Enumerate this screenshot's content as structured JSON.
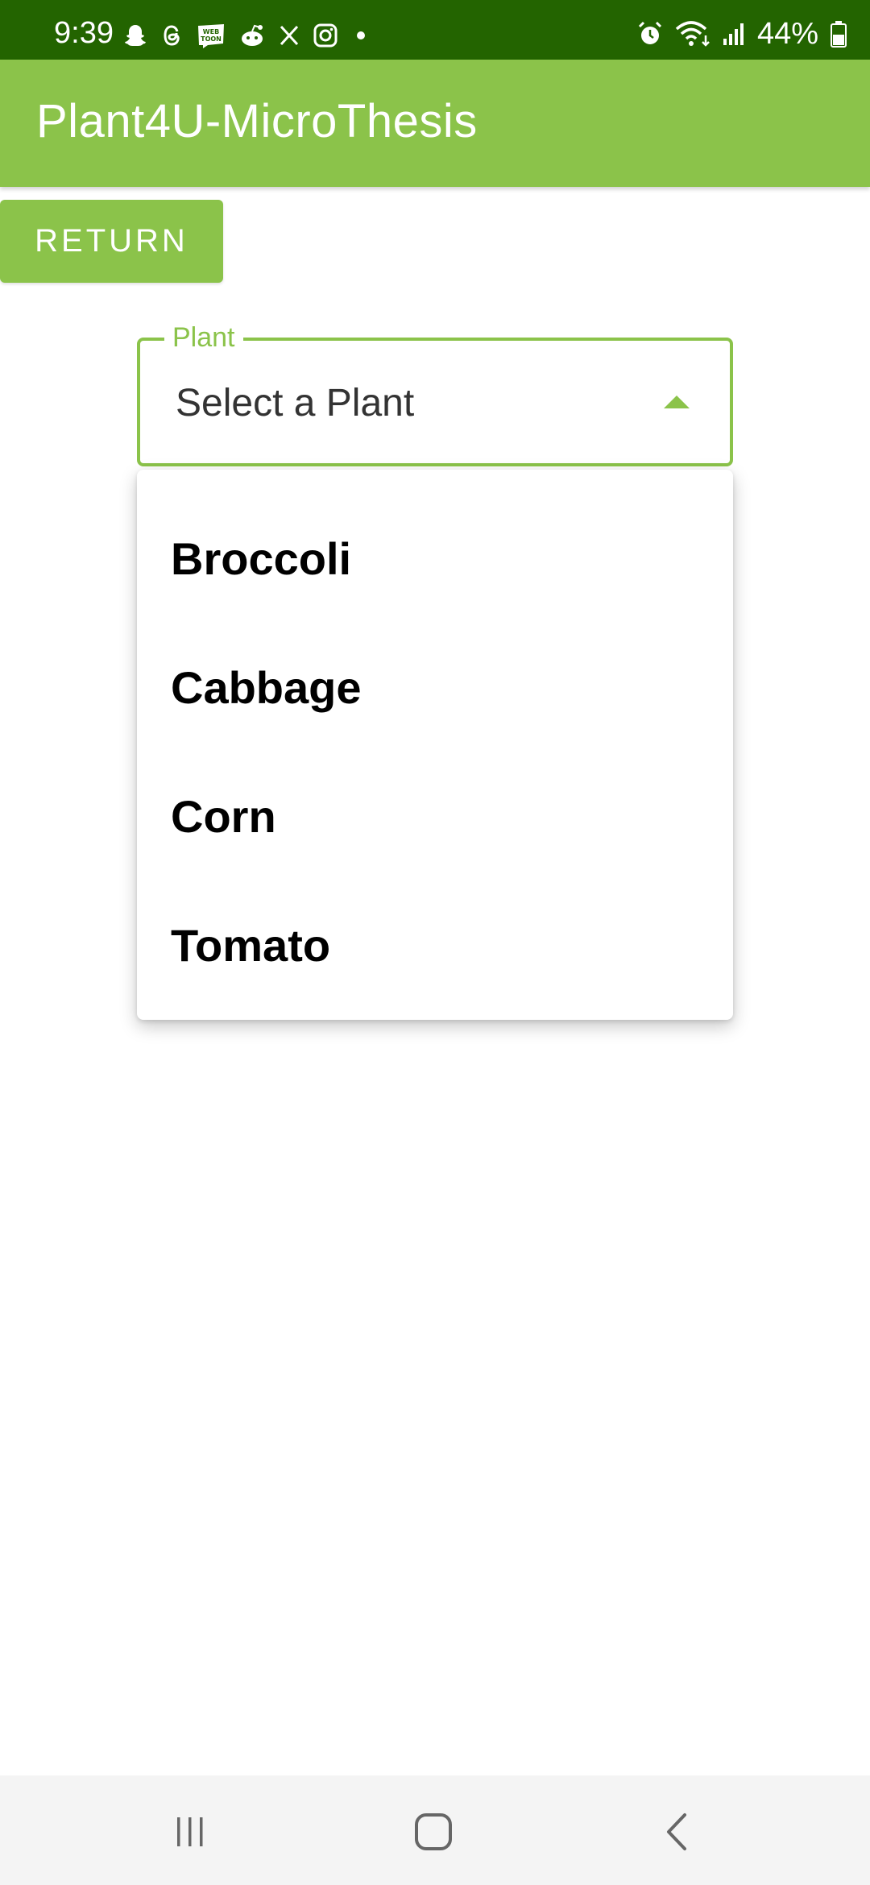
{
  "status_bar": {
    "time": "9:39",
    "battery_text": "44%",
    "left_icons": [
      "snapchat-icon",
      "threads-icon",
      "webtoon-icon",
      "reddit-icon",
      "x-icon",
      "instagram-icon",
      "dot-icon"
    ],
    "right_icons": [
      "alarm-icon",
      "wifi-icon",
      "signal-icon",
      "battery-icon"
    ]
  },
  "app_bar": {
    "title": "Plant4U-MicroThesis"
  },
  "return_button": {
    "label": "RETURN"
  },
  "plant_select": {
    "label": "Plant",
    "value": "Select a Plant",
    "options": [
      "Broccoli",
      "Cabbage",
      "Corn",
      "Tomato"
    ]
  },
  "nav_bar": {
    "icons": [
      "recents-icon",
      "home-icon",
      "back-icon"
    ]
  },
  "colors": {
    "status_bar": "#236400",
    "accent": "#8bc34a",
    "nav_bar": "#f4f4f4"
  }
}
